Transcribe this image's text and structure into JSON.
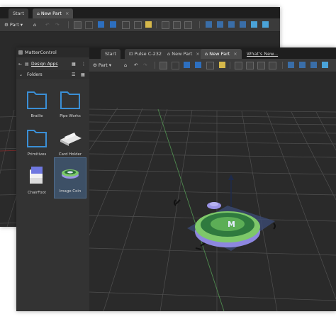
{
  "back_window": {
    "tabs": [
      {
        "label": "Start"
      },
      {
        "label": "New Part",
        "close": "×"
      }
    ],
    "toolbar": {
      "part_menu": "Part ▾"
    }
  },
  "front_window": {
    "tabs": [
      {
        "label": "Start"
      },
      {
        "label": "Pulse C-232",
        "close": "×"
      },
      {
        "label": "New Part",
        "close": "×"
      },
      {
        "label": "New Part",
        "close": "×"
      },
      {
        "label": "What's New..."
      }
    ],
    "toolbar": {
      "part_menu": "Part ▾"
    },
    "sidebar": {
      "title": "MatterControl",
      "breadcrumb": "Design Apps",
      "section": "Folders",
      "items": [
        {
          "label": "Braille"
        },
        {
          "label": "Pipe Works"
        },
        {
          "label": "Primitives"
        },
        {
          "label": "Card Holder"
        },
        {
          "label": "ChairFoot"
        },
        {
          "label": "Image Coin"
        }
      ]
    },
    "coin_label": "M"
  },
  "colors": {
    "accent_blue": "#1e88e5",
    "folder_blue": "#3a8fd6",
    "grid_line": "#555555",
    "coin_green": "#7ec86a",
    "coin_purple": "#9a93e6"
  }
}
